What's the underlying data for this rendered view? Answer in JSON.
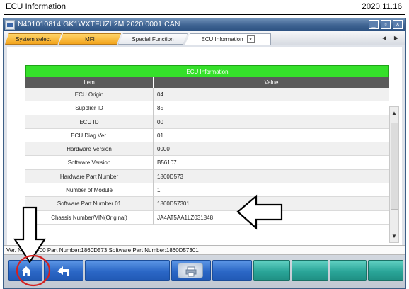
{
  "document": {
    "title": "ECU Information",
    "date": "2020.11.16"
  },
  "window": {
    "title": "N401010814  GK1WXTFUZL2M 2020   0001 CAN",
    "controls": {
      "minimize": "_",
      "restore": "▫",
      "close": "×"
    }
  },
  "tabs": [
    {
      "label": "System select"
    },
    {
      "label": "MFI"
    },
    {
      "label": "Special Function"
    },
    {
      "label": "ECU Information",
      "close": "×"
    }
  ],
  "tab_nav": {
    "prev": "◀",
    "next": "▶"
  },
  "table": {
    "title": "ECU Information",
    "columns": {
      "item": "Item",
      "value": "Value"
    },
    "rows": [
      {
        "item": "ECU Origin",
        "value": "04"
      },
      {
        "item": "Supplier ID",
        "value": "85"
      },
      {
        "item": "ECU ID",
        "value": "00"
      },
      {
        "item": "ECU Diag Ver.",
        "value": "01"
      },
      {
        "item": "Hardware Version",
        "value": "0000"
      },
      {
        "item": "Software Version",
        "value": "B56107"
      },
      {
        "item": "Hardware Part Number",
        "value": "1860D573"
      },
      {
        "item": "Number of Module",
        "value": "1"
      },
      {
        "item": "Software Part Number 01",
        "value": "1860D57301"
      },
      {
        "item": "Chassis Number/VIN(Original)",
        "value": "JA4AT5AA1LZ031848"
      }
    ]
  },
  "scrollbar": {
    "up": "▲",
    "down": "▼"
  },
  "status": {
    "text": "Ver. N20071-00 Part Number:1860D573   Software Part Number:1860D57301"
  },
  "bottom_buttons": [
    {
      "icon": "home-icon"
    },
    {
      "icon": "return-arrow-icon"
    },
    {
      "icon": "none"
    },
    {
      "icon": "print-icon"
    },
    {
      "icon": "none"
    },
    {
      "icon": "none"
    },
    {
      "icon": "none"
    },
    {
      "icon": "none"
    },
    {
      "icon": "none"
    }
  ],
  "colors": {
    "table_header": "#35e02a",
    "annotation": "#d42020",
    "button_blue": "#2b67c6",
    "button_teal": "#2aa598"
  }
}
